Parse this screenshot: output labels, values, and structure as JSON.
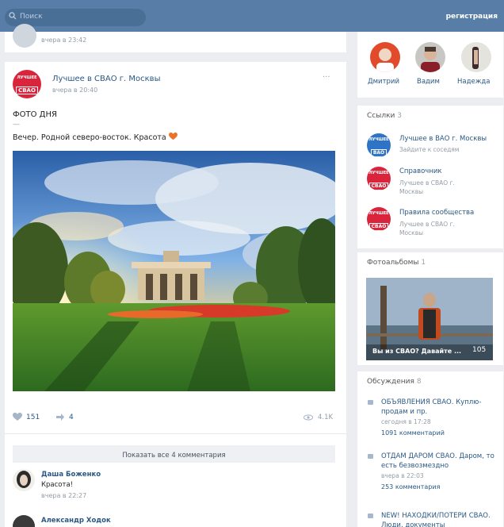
{
  "search": {
    "placeholder": "Поиск"
  },
  "header": {
    "register_label": "регистрация"
  },
  "prev_post": {
    "time": "вчера в 23:42"
  },
  "post": {
    "author": "Лучшее в СВАО г. Москвы",
    "time": "вчера в 20:40",
    "more": "···",
    "title": "ФОТО ДНЯ",
    "dash": "—",
    "text": "Вечер. Родной северо-восток. Красота",
    "likes": "151",
    "reposts": "4",
    "views": "4.1K"
  },
  "logo": {
    "line1": "ЛУЧШЕЕ",
    "line2": "СВАО"
  },
  "comments": {
    "show_all_label": "Показать все 4 комментария",
    "items": [
      {
        "author": "Даша Боженко",
        "text": "Красота!",
        "time": "вчера в 22:27"
      },
      {
        "author": "Александр Ходок"
      }
    ]
  },
  "members": [
    {
      "name": "Дмитрий"
    },
    {
      "name": "Вадим"
    },
    {
      "name": "Надежда"
    }
  ],
  "links": {
    "title": "Ссылки",
    "count": "3",
    "items": [
      {
        "name": "Лучшее в ВАО г. Москвы",
        "desc": "Зайдите к соседям",
        "logo_line1": "ЛУЧШЕЕ",
        "logo_line2": "ВАО"
      },
      {
        "name": "Справочник",
        "desc": "Лучшее в СВАО г. Москвы",
        "logo_line1": "ЛУЧШЕЕ",
        "logo_line2": "СВАО"
      },
      {
        "name": "Правила сообщества",
        "desc": "Лучшее в СВАО г. Москвы",
        "logo_line1": "ЛУЧШЕЕ",
        "logo_line2": "СВАО"
      }
    ]
  },
  "albums": {
    "title": "Фотоальбомы",
    "count": "1",
    "album_title": "Вы из СВАО? Давайте ...",
    "album_count": "105"
  },
  "discussions": {
    "title": "Обсуждения",
    "count": "8",
    "items": [
      {
        "title": "ОБЪЯВЛЕНИЯ СВАО. Куплю-продам и пр.",
        "time": "сегодня в 17:28",
        "comments": "1091 комментарий"
      },
      {
        "title": "ОТДАМ ДАРОМ СВАО. Даром, то есть безвозмездно",
        "time": "вчера в 22:03",
        "comments": "253 комментария"
      },
      {
        "title": "NEW! НАХОДКИ/ПОТЕРИ СВАО. Люди, документы"
      }
    ]
  },
  "colors": {
    "header": "#587ea8",
    "accent_link": "#2a5885",
    "logo_red": "#d9243b",
    "logo_blue": "#2f73c6",
    "background": "#ecedf0"
  }
}
